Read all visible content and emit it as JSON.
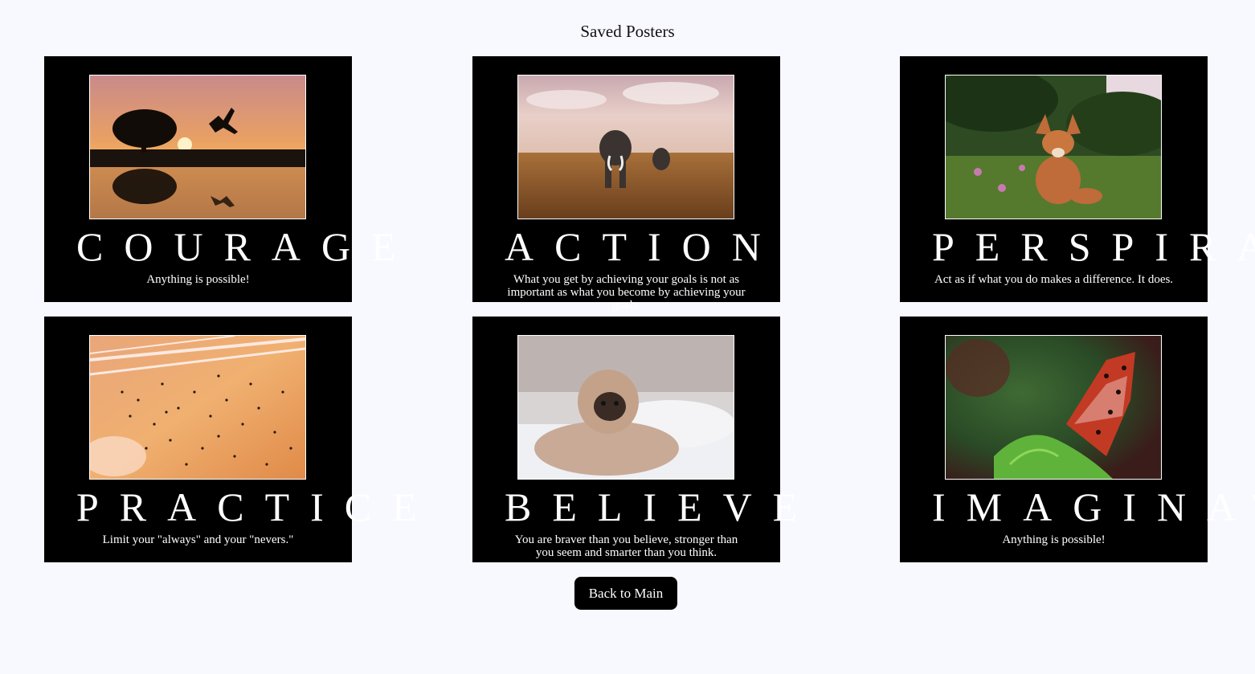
{
  "page_title": "Saved Posters",
  "posters": [
    {
      "title": "Courage",
      "quote": "Anything is possible!",
      "image": "sunset-jumper-photo"
    },
    {
      "title": "Action",
      "quote": "What you get by achieving your goals is not as important as what you become by achieving your goals.",
      "image": "elephants-savanna-photo"
    },
    {
      "title": "Perspiration",
      "quote": "Act as if what you do makes a difference. It does.",
      "image": "fox-meadow-photo"
    },
    {
      "title": "Practice",
      "quote": "Limit your \"always\" and your \"nevers.\"",
      "image": "bird-flock-sunset-photo"
    },
    {
      "title": "Believe",
      "quote": "You are braver than you believe, stronger than you seem and smarter than you think.",
      "image": "pug-blanket-photo"
    },
    {
      "title": "Imagination",
      "quote": "Anything is possible!",
      "image": "butterfly-fern-photo"
    }
  ],
  "back_button_label": "Back to Main"
}
